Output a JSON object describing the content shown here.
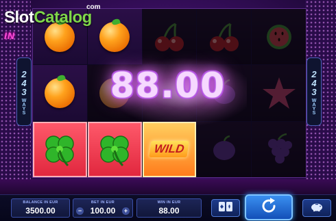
{
  "watermark": {
    "brand_a": "Slot",
    "brand_b": "Catalog",
    "suffix": "com"
  },
  "game_logo_fragment": "IN",
  "ways": {
    "left_number": "243",
    "left_label": "WAYS",
    "right_number": "243",
    "right_label": "WAYS"
  },
  "win_display": "88.00",
  "reels": [
    [
      "orange",
      "orange",
      "clover"
    ],
    [
      "orange",
      "orange-dim",
      "clover"
    ],
    [
      "cherry",
      "blank",
      "wild"
    ],
    [
      "cherry",
      "plum",
      "plum"
    ],
    [
      "melon",
      "star",
      "grapes"
    ]
  ],
  "wild_label": "WILD",
  "bottom_bar": {
    "balance_caption": "BALANCE IN EUR",
    "balance_value": "3500.00",
    "bet_caption": "BET IN EUR",
    "bet_value": "100.00",
    "bet_minus": "−",
    "bet_plus": "+",
    "win_caption": "WIN IN EUR",
    "win_value": "88.00"
  },
  "icons": {
    "cards": "cards-icon",
    "spin": "spin-icon",
    "piggy": "piggy-bank-icon"
  },
  "colors": {
    "accent_purple": "#b04ae0",
    "button_blue": "#1d3b8a",
    "win_tile_red": "#e0263d"
  }
}
